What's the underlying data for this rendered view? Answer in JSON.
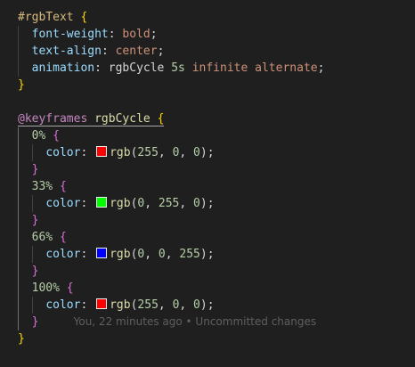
{
  "selector": "#rgbText",
  "rule_props": [
    {
      "prop": "font-weight",
      "value": "bold"
    },
    {
      "prop": "text-align",
      "value": "center"
    },
    {
      "prop": "animation",
      "name": "rgbCycle",
      "duration": "5s",
      "iteration": "infinite",
      "direction": "alternate"
    }
  ],
  "at_keyword": "@keyframes",
  "keyframes_name": "rgbCycle",
  "keyframes": [
    {
      "stop": "0%",
      "prop": "color",
      "fn": "rgb",
      "args": [
        "255",
        "0",
        "0"
      ],
      "swatch_color": "#ff0000"
    },
    {
      "stop": "33%",
      "prop": "color",
      "fn": "rgb",
      "args": [
        "0",
        "255",
        "0"
      ],
      "swatch_color": "#00ff00"
    },
    {
      "stop": "66%",
      "prop": "color",
      "fn": "rgb",
      "args": [
        "0",
        "0",
        "255"
      ],
      "swatch_color": "#0000ff"
    },
    {
      "stop": "100%",
      "prop": "color",
      "fn": "rgb",
      "args": [
        "255",
        "0",
        "0"
      ],
      "swatch_color": "#ff0000"
    }
  ],
  "blame": "You, 22 minutes ago • Uncommitted changes",
  "colors": {
    "background": "#1f1f1f",
    "selector": "#d7ba7d",
    "property": "#9cdcfe",
    "value": "#ce9178",
    "number": "#b5cea8",
    "keyword": "#c586c0",
    "function": "#dcdcaa",
    "bracket_level1": "#ffd700",
    "bracket_level2": "#da70d6"
  }
}
